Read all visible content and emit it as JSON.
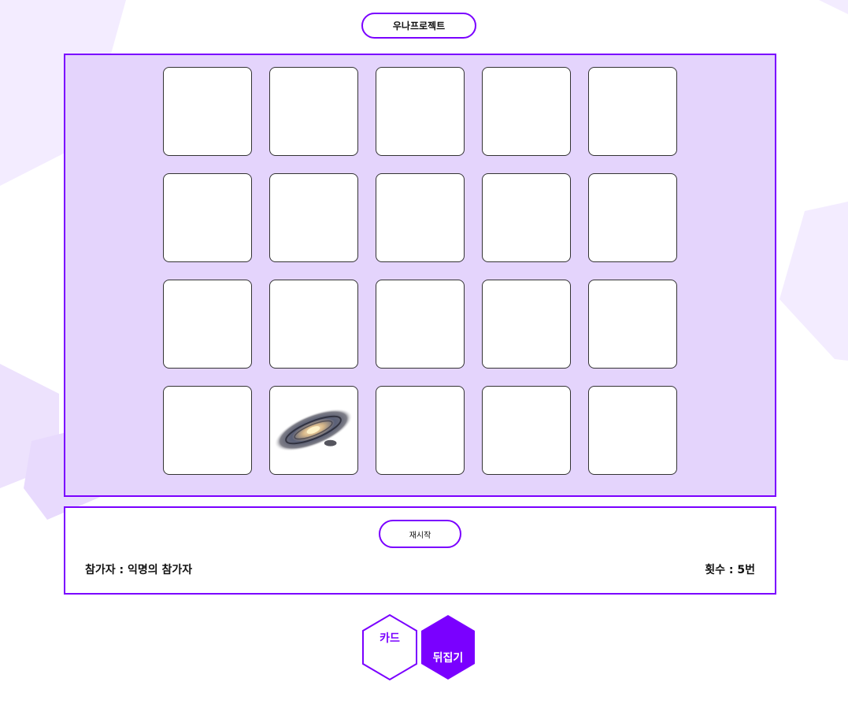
{
  "header": {
    "title": "우나프로젝트"
  },
  "board": {
    "rows": 4,
    "cols": 5,
    "cards": [
      {
        "state": "hidden"
      },
      {
        "state": "hidden"
      },
      {
        "state": "hidden"
      },
      {
        "state": "hidden"
      },
      {
        "state": "hidden"
      },
      {
        "state": "hidden"
      },
      {
        "state": "hidden"
      },
      {
        "state": "hidden"
      },
      {
        "state": "hidden"
      },
      {
        "state": "hidden"
      },
      {
        "state": "hidden"
      },
      {
        "state": "hidden"
      },
      {
        "state": "hidden"
      },
      {
        "state": "hidden"
      },
      {
        "state": "hidden"
      },
      {
        "state": "hidden"
      },
      {
        "state": "revealed",
        "image": "galaxy-image"
      },
      {
        "state": "hidden"
      },
      {
        "state": "hidden"
      },
      {
        "state": "hidden"
      }
    ]
  },
  "controls": {
    "restart_label": "재시작",
    "participant_text": "참가자 : 익명의 참가자",
    "count_text": "횟수 : 5번"
  },
  "logo": {
    "left_text": "카드",
    "right_text": "뒤집기"
  },
  "colors": {
    "accent": "#7a00ff",
    "board_bg": "#e4d4fc",
    "bg_shape": "#efe6fe"
  }
}
